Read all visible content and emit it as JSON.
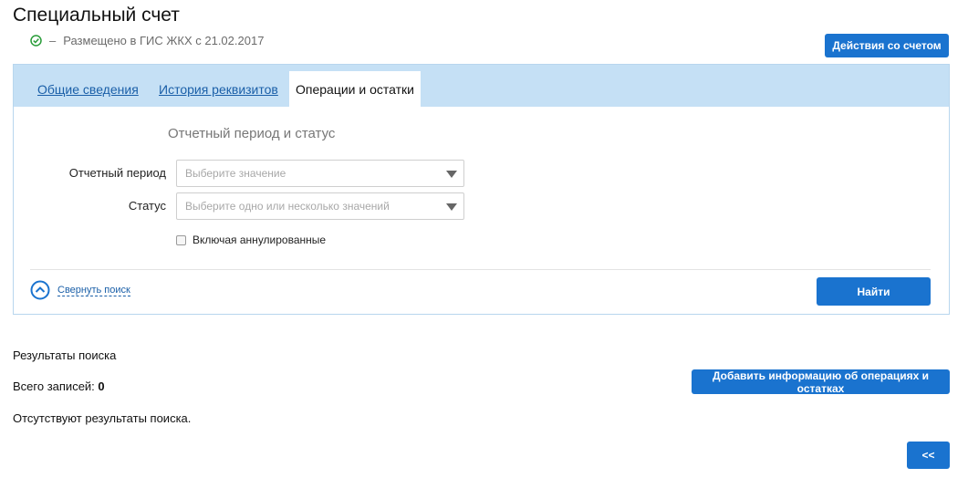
{
  "page": {
    "title": "Специальный счет",
    "status_dash": "–",
    "status_text": "Размещено в ГИС ЖКХ с 21.02.2017",
    "status_color": "#2a9d3a"
  },
  "actions_button": "Действия со счетом",
  "tabs": [
    {
      "label": "Общие сведения",
      "active": false
    },
    {
      "label": "История реквизитов",
      "active": false
    },
    {
      "label": "Операции и остатки",
      "active": true
    }
  ],
  "search_form": {
    "section_title": "Отчетный период и статус",
    "period_label": "Отчетный период",
    "period_placeholder": "Выберите значение",
    "status_label": "Статус",
    "status_placeholder": "Выберите одно или несколько значений",
    "include_cancelled_label": "Включая аннулированные",
    "include_cancelled_checked": false,
    "collapse_label": "Свернуть поиск",
    "find_button": "Найти"
  },
  "results": {
    "title": "Результаты поиска",
    "total_label": "Всего записей:",
    "total_count": "0",
    "empty_message": "Отсутствуют результаты поиска.",
    "add_button": "Добавить информацию об операциях и остатках",
    "back_button": "<<"
  },
  "colors": {
    "accent": "#1a73cf",
    "tab_bar": "#c5e0f5",
    "link": "#1a5fa8"
  }
}
